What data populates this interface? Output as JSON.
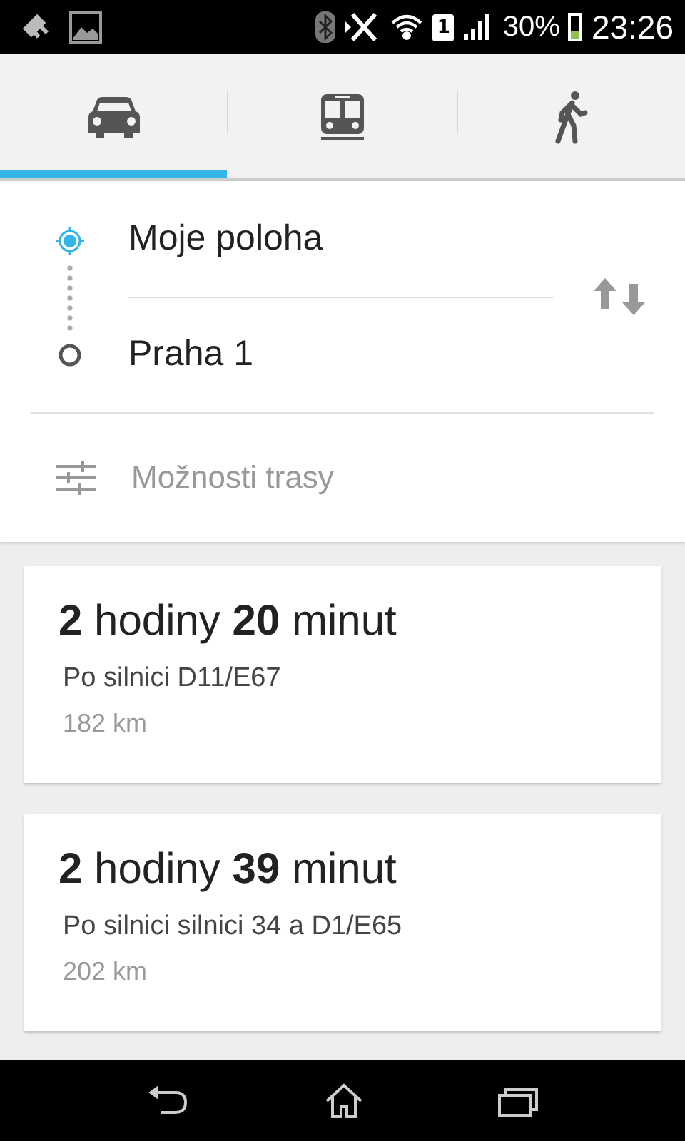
{
  "status_bar": {
    "sim": "1",
    "battery_text": "30%",
    "time": "23:26"
  },
  "tabs": [
    {
      "kind": "car",
      "selected": true
    },
    {
      "kind": "bus",
      "selected": false
    },
    {
      "kind": "walk",
      "selected": false
    }
  ],
  "route_form": {
    "origin": "Moje poloha",
    "destination": "Praha 1",
    "options": "Možnosti trasy"
  },
  "routes": [
    {
      "duration": "**2** hodiny **20** minut",
      "via": "Po silnici D11/E67",
      "distance": "182 km"
    },
    {
      "duration": "**2** hodiny **39** minut",
      "via": "Po silnici silnici 34 a D1/E65",
      "distance": "202 km"
    }
  ]
}
